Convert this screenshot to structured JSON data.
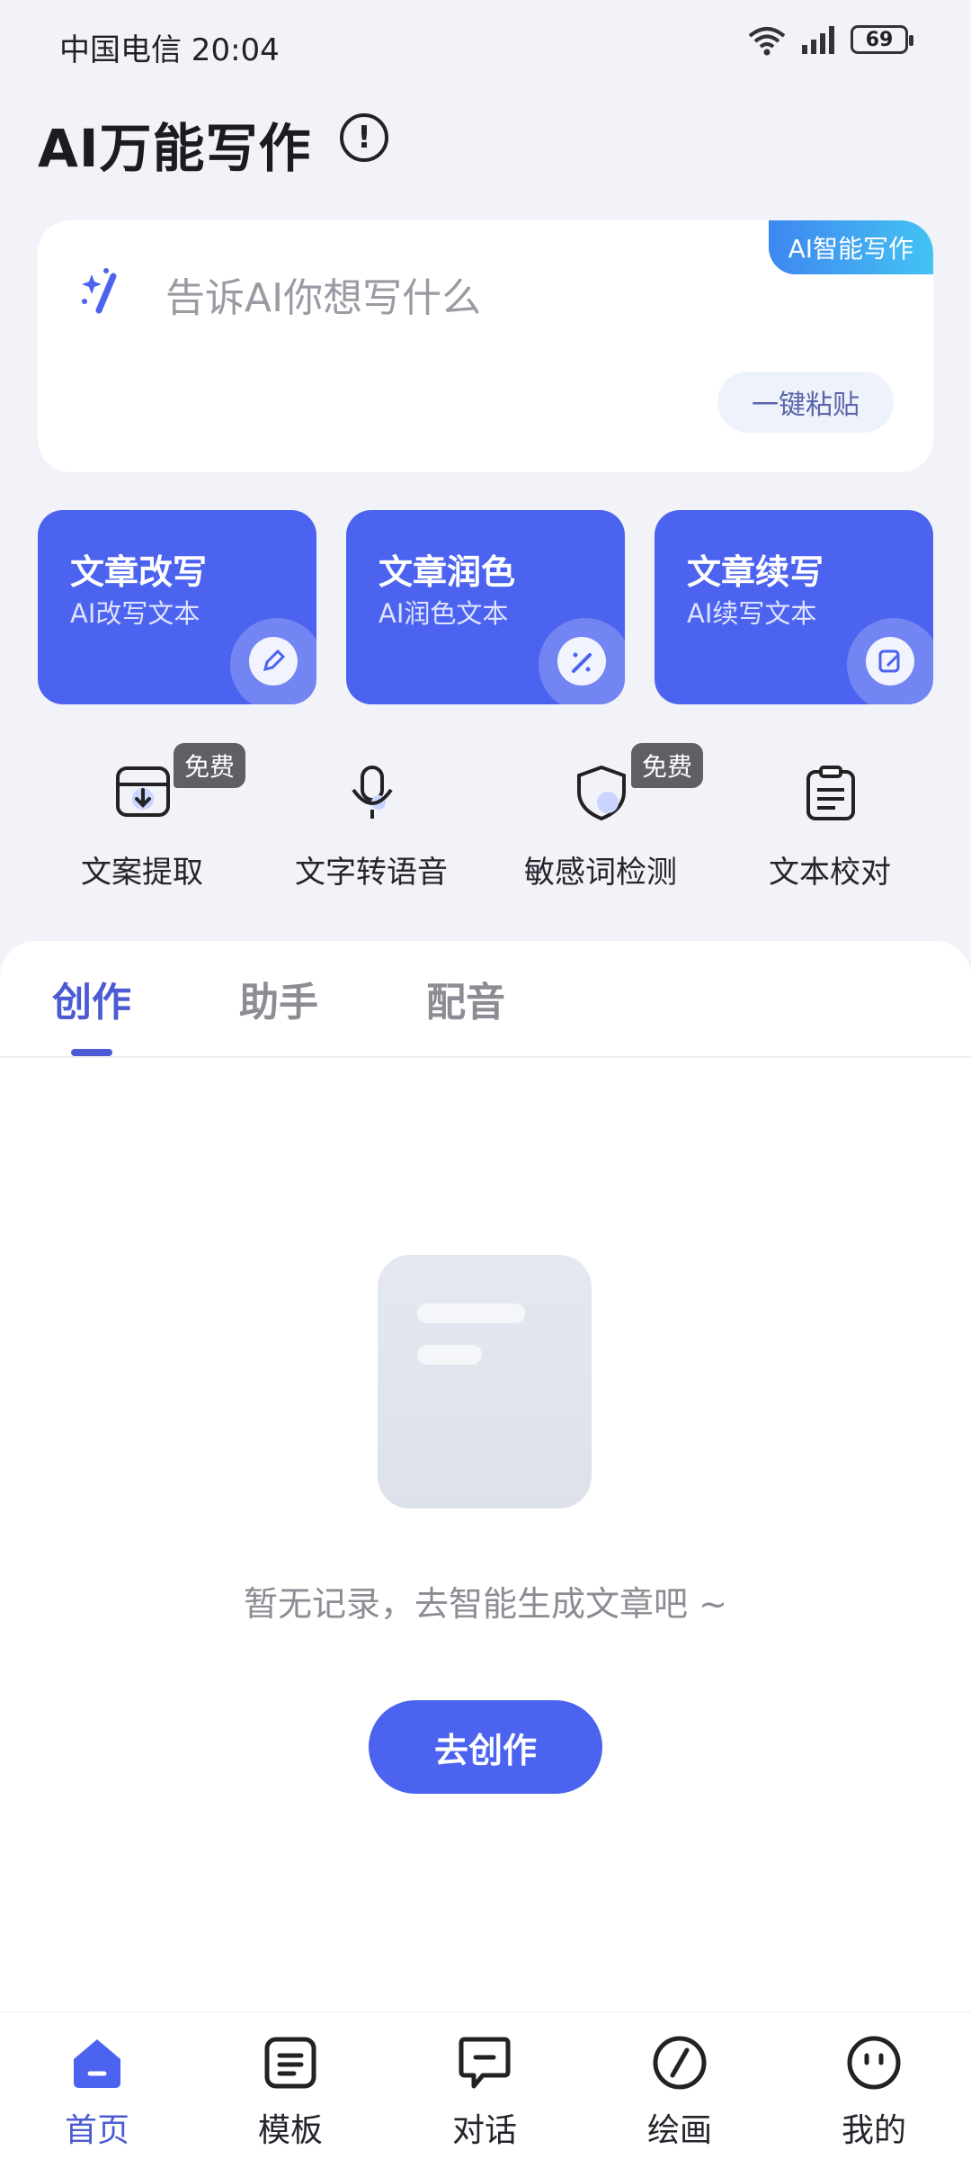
{
  "status_bar": {
    "carrier_time": "中国电信 20:04",
    "wifi": "6",
    "signal": "5G",
    "battery": "69"
  },
  "header": {
    "title": "AI万能写作",
    "info_icon": "!"
  },
  "prompt": {
    "badge": "AI智能写作",
    "placeholder": "告诉AI你想写什么",
    "paste_label": "一键粘贴"
  },
  "features": [
    {
      "title": "文章改写",
      "subtitle": "AI改写文本",
      "icon": "edit-icon"
    },
    {
      "title": "文章润色",
      "subtitle": "AI润色文本",
      "icon": "magic-wand-icon"
    },
    {
      "title": "文章续写",
      "subtitle": "AI续写文本",
      "icon": "note-edit-icon"
    }
  ],
  "tools": [
    {
      "label": "文案提取",
      "badge": "免费",
      "icon": "download-icon"
    },
    {
      "label": "文字转语音",
      "icon": "microphone-icon"
    },
    {
      "label": "敏感词检测",
      "badge": "免费",
      "icon": "shield-icon"
    },
    {
      "label": "文本校对",
      "icon": "clipboard-icon"
    }
  ],
  "tabs": [
    {
      "label": "创作",
      "active": true
    },
    {
      "label": "助手",
      "active": false
    },
    {
      "label": "配音",
      "active": false
    }
  ],
  "empty_state": {
    "message": "暂无记录，去智能生成文章吧 ~",
    "button": "去创作"
  },
  "nav": [
    {
      "label": "首页",
      "active": true,
      "icon": "home-icon"
    },
    {
      "label": "模板",
      "active": false,
      "icon": "template-icon"
    },
    {
      "label": "对话",
      "active": false,
      "icon": "chat-icon"
    },
    {
      "label": "绘画",
      "active": false,
      "icon": "paint-icon"
    },
    {
      "label": "我的",
      "active": false,
      "icon": "profile-icon"
    }
  ],
  "colors": {
    "accent": "#4c63ef",
    "accent_text": "#4c5bd4",
    "background": "#f1f3f8",
    "badge_gradient_start": "#3e87f0",
    "badge_gradient_end": "#43c3f2"
  }
}
